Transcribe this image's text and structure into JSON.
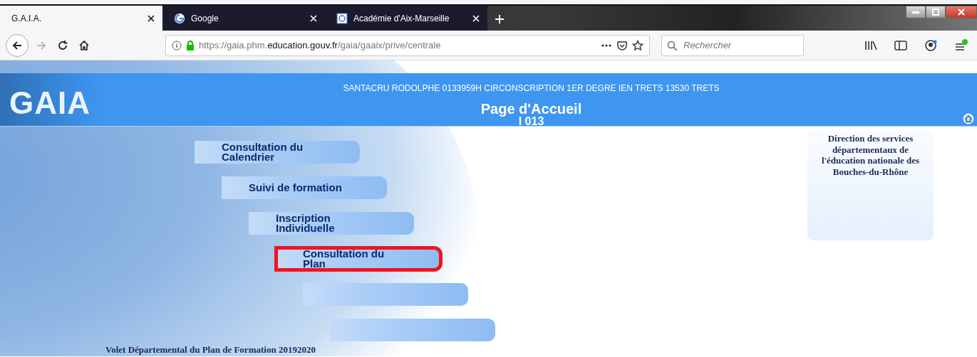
{
  "browser": {
    "tabs": [
      {
        "title": "G.A.I.A.",
        "kind": "plain",
        "selected": true
      },
      {
        "title": "Google",
        "kind": "google",
        "selected": false
      },
      {
        "title": "Académie d'Aix-Marseille",
        "kind": "academie",
        "selected": false
      }
    ],
    "url": {
      "host_prefix": "https://gaia.phm.",
      "host": "education.gouv.fr",
      "path": "/gaia/gaaix/prive/centrale"
    },
    "search": {
      "placeholder": "Rechercher"
    }
  },
  "header": {
    "logo": "GAIA",
    "user_line": "SANTACRU RODOLPHE 0133959H CIRCONSCRIPTION 1ER DEGRE IEN TRETS 13530 TRETS",
    "page_title": "Page d'Accueil",
    "code": "I 013"
  },
  "menu": [
    {
      "label": "Consultation du Calendrier",
      "highlighted": false
    },
    {
      "label": "Suivi de formation",
      "highlighted": false
    },
    {
      "label": "Inscription Individuelle",
      "highlighted": false
    },
    {
      "label": "Consultation du Plan",
      "highlighted": true
    },
    {
      "highlighted": false
    },
    {
      "highlighted": false
    }
  ],
  "side_panel": {
    "text": "Direction des services départementaux de l'éducation nationale des Bouches-du-Rhône"
  },
  "footer": {
    "text": "Volet Départemental du Plan de Formation 20192020"
  }
}
